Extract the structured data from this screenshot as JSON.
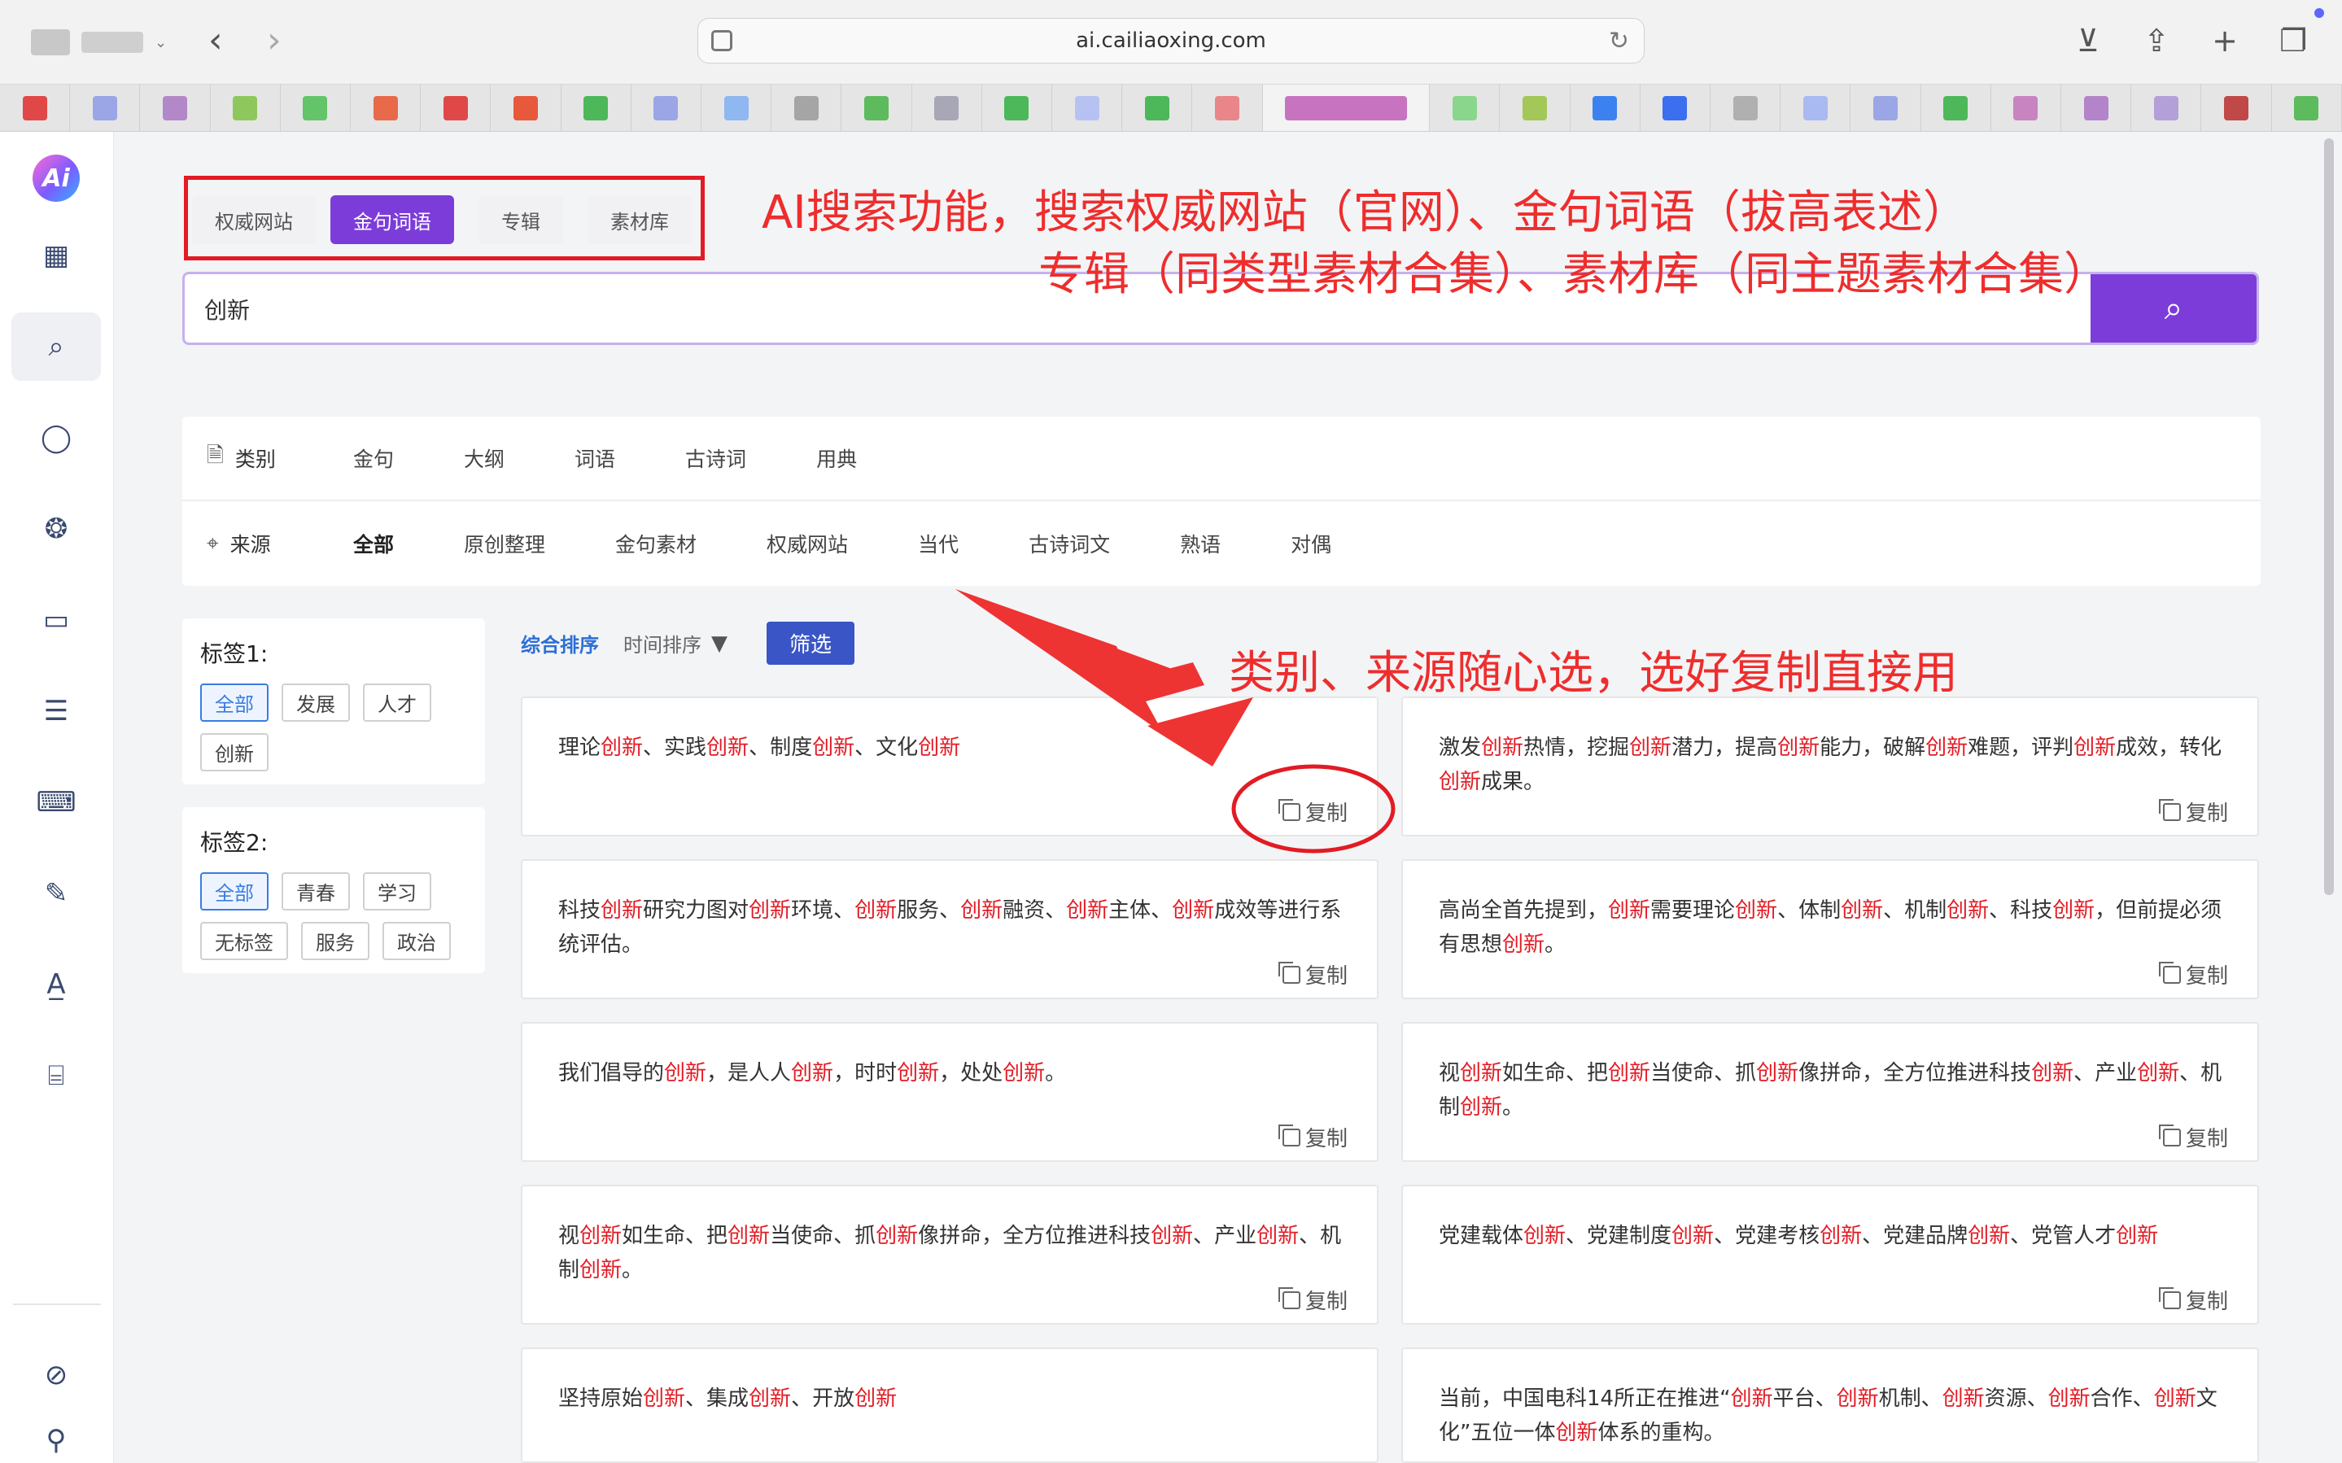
{
  "browser": {
    "url": "ai.cailiaoxing.com"
  },
  "type_tabs": [
    "权威网站",
    "金句词语",
    "专辑",
    "素材库"
  ],
  "search": {
    "value": "创新"
  },
  "annotations": {
    "line1": "AI搜索功能，搜索权威网站（官网）、金句词语（拔高表述）",
    "line2": "专辑（同类型素材合集）、素材库（同主题素材合集）",
    "line3": "类别、来源随心选，选好复制直接用"
  },
  "filters": {
    "category_label": "类别",
    "category_options": [
      "金句",
      "大纲",
      "词语",
      "古诗词",
      "用典"
    ],
    "source_label": "来源",
    "source_options": [
      "全部",
      "原创整理",
      "金句素材",
      "权威网站",
      "当代",
      "古诗词文",
      "熟语",
      "对偶"
    ]
  },
  "tags1": {
    "title": "标签1:",
    "items": [
      "全部",
      "发展",
      "人才",
      "创新"
    ]
  },
  "tags2": {
    "title": "标签2:",
    "items": [
      "全部",
      "青春",
      "学习",
      "无标签",
      "服务",
      "政治"
    ]
  },
  "sort": {
    "primary": "综合排序",
    "secondary": "时间排序",
    "filter_button": "筛选"
  },
  "copy_label": "复制",
  "keyword": "创新",
  "cards": [
    "理论创新、实践创新、制度创新、文化创新",
    "激发创新热情，挖掘创新潜力，提高创新能力，破解创新难题，评判创新成效，转化创新成果。",
    "科技创新研究力图对创新环境、创新服务、创新融资、创新主体、创新成效等进行系统评估。",
    "高尚全首先提到，创新需要理论创新、体制创新、机制创新、科技创新，但前提必须有思想创新。",
    "我们倡导的创新，是人人创新，时时创新，处处创新。",
    "视创新如生命、把创新当使命、抓创新像拼命，全方位推进科技创新、产业创新、机制创新。",
    "视创新如生命、把创新当使命、抓创新像拼命，全方位推进科技创新、产业创新、机制创新。",
    "党建载体创新、党建制度创新、党建考核创新、党建品牌创新、党管人才创新",
    "坚持原始创新、集成创新、开放创新",
    "当前，中国电科14所正在推进“创新平台、创新机制、创新资源、创新合作、创新文化”五位一体创新体系的重构。"
  ],
  "colors": {
    "accent": "#7c3cd9",
    "highlight": "#e21b24",
    "annotation": "#ee2d2d",
    "link": "#2c6fd6"
  }
}
